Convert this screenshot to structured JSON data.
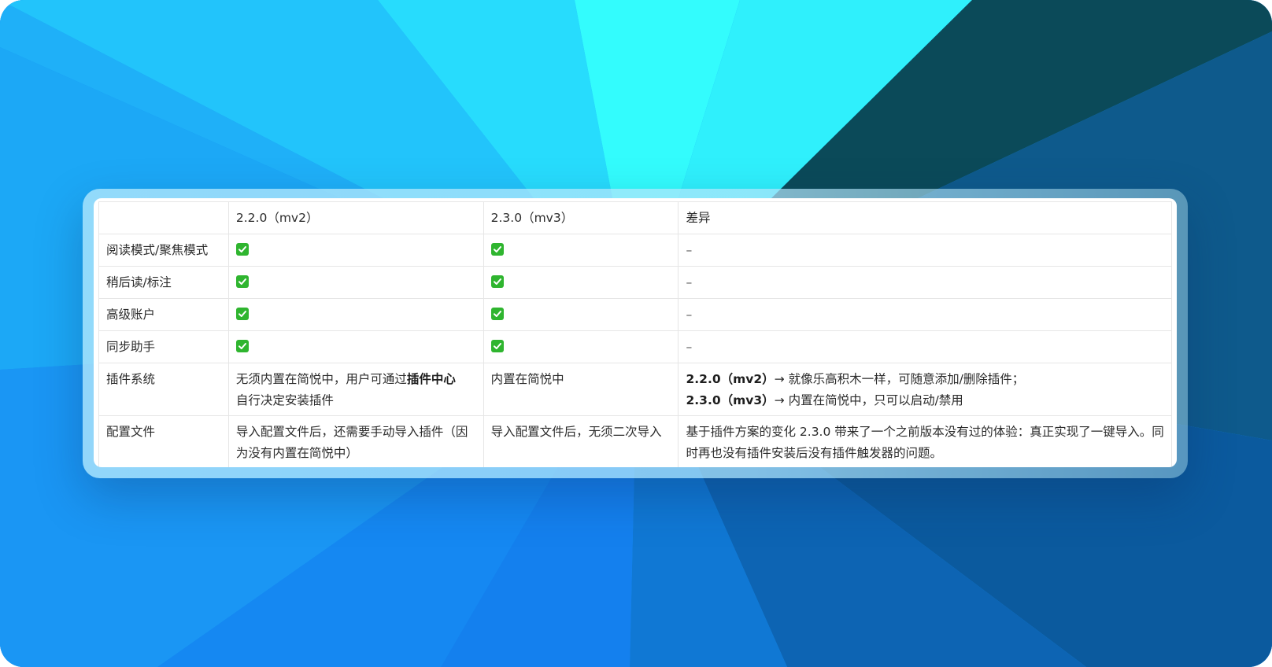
{
  "table": {
    "headers": [
      "",
      "2.2.0（mv2）",
      "2.3.0（mv3）",
      "差异"
    ],
    "feature_rows": [
      {
        "feature": "阅读模式/聚焦模式",
        "diff": "–"
      },
      {
        "feature": "稍后读/标注",
        "diff": "–"
      },
      {
        "feature": "高级账户",
        "diff": "–"
      },
      {
        "feature": "同步助手",
        "diff": "–"
      }
    ],
    "plugin_row": {
      "feature": "插件系统",
      "mv2_prefix": "无须内置在简悦中，用户可通过",
      "mv2_bold": "插件中心",
      "mv2_suffix": "自行决定安装插件",
      "mv3": "内置在简悦中",
      "diff_line1_bold": "2.2.0（mv2）",
      "diff_line1": "→ 就像乐高积木一样，可随意添加/删除插件；",
      "diff_line2_bold": "2.3.0（mv3）",
      "diff_line2": "→ 内置在简悦中，只可以启动/禁用"
    },
    "config_row": {
      "feature": "配置文件",
      "mv2": "导入配置文件后，还需要手动导入插件（因为没有内置在简悦中）",
      "mv3": "导入配置文件后，无须二次导入",
      "diff": "基于插件方案的变化 2.3.0 带来了一个之前版本没有过的体验：真正实现了一键导入。同时再也没有插件安装后没有插件触发器的问题。"
    }
  },
  "icons": {
    "check": "check-mark-button-icon"
  },
  "colors": {
    "check_green": "#2fb52f",
    "background_blue": "#1a8ef0",
    "background_cyan": "#33ffff",
    "background_dark_teal": "#0c4a58"
  }
}
